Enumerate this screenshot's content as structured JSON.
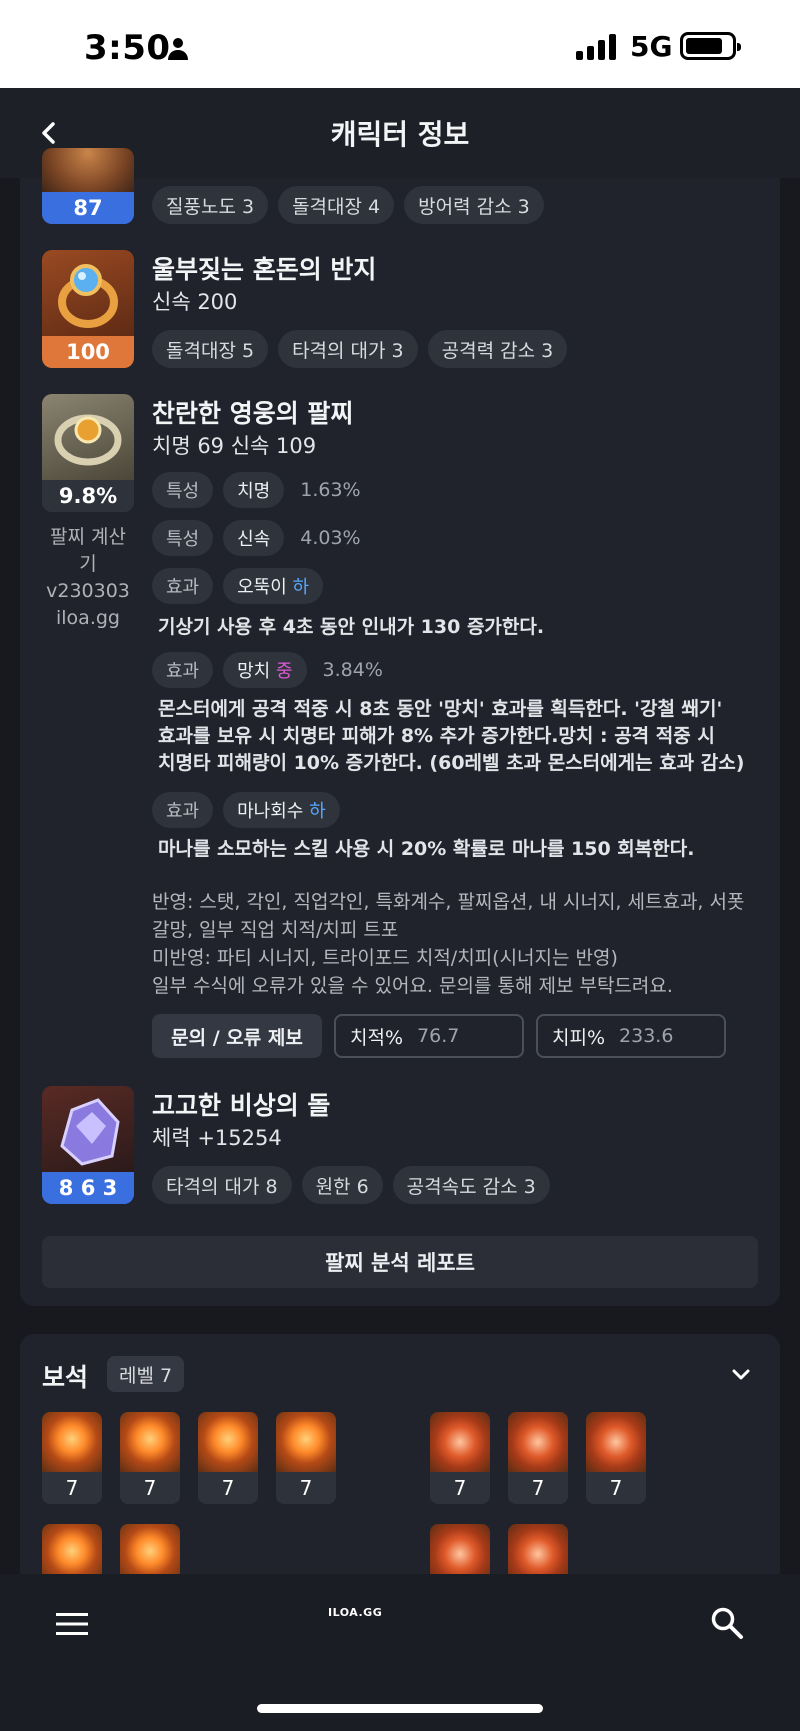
{
  "status_bar": {
    "time": "3:50",
    "network": "5G"
  },
  "header": {
    "title": "캐릭터 정보"
  },
  "items": [
    {
      "level": "87",
      "chips": [
        "질풍노도 3",
        "돌격대장 4",
        "방어력 감소 3"
      ]
    },
    {
      "name": "울부짖는 혼돈의 반지",
      "stat": "신속 200",
      "level": "100",
      "chips": [
        "돌격대장 5",
        "타격의 대가 3",
        "공격력 감소 3"
      ]
    }
  ],
  "bracelet": {
    "name": "찬란한 영웅의 팔찌",
    "stat": "치명 69  신속 109",
    "percent": "9.8%",
    "calc_label": [
      "팔찌 계산기",
      "v230303",
      "iloa.gg"
    ],
    "rows": [
      {
        "type": "특성",
        "name": "치명",
        "value": "1.63%"
      },
      {
        "type": "특성",
        "name": "신속",
        "value": "4.03%"
      },
      {
        "type": "효과",
        "name": "오뚝이",
        "grade": "하",
        "value": ""
      },
      {
        "type": "효과",
        "name": "망치",
        "grade": "중",
        "value": "3.84%"
      },
      {
        "type": "효과",
        "name": "마나회수",
        "grade": "하",
        "value": ""
      }
    ],
    "desc_ottugi": "기상기 사용 후 4초 동안 인내가 130 증가한다.",
    "desc_hammer": [
      "몬스터에게 공격 적중 시 8초 동안 '망치' 효과를 획득한다. '강철 쐐기'",
      "효과를 보유 시 치명타 피해가 8% 추가 증가한다.망치 : 공격 적중 시",
      "치명타 피해량이 10% 증가한다. (60레벨 초과 몬스터에게는 효과 감소)"
    ],
    "desc_mana": "마나를 소모하는 스킬 사용 시 20% 확률로 마나를 150 회복한다.",
    "notes": [
      "반영: 스탯, 각인, 직업각인, 특화계수, 팔찌옵션, 내 시너지, 세트효과, 서폿",
      "갈망, 일부 직업 치적/치피 트포",
      "미반영: 파티 시너지, 트라이포드 치적/치피(시너지는 반영)",
      "일부 수식에 오류가 있을 수 있어요. 문의를 통해 제보 부탁드려요."
    ],
    "report_button": "문의 / 오류 제보",
    "crit_rate_label": "치적%",
    "crit_rate_value": "76.7",
    "crit_dmg_label": "치피%",
    "crit_dmg_value": "233.6"
  },
  "stone": {
    "name": "고고한 비상의 돌",
    "stat": "체력 +15254",
    "level": "8 6 3",
    "chips": [
      "타격의 대가 8",
      "원한 6",
      "공격속도 감소 3"
    ]
  },
  "analysis_button": "팔찌 분석 레포트",
  "gems": {
    "title": "보석",
    "badge": "레벨 7",
    "row1": [
      "7",
      "7",
      "7",
      "7",
      "7",
      "7",
      "7"
    ]
  },
  "bottom_bar": {
    "logo": "ILOA.GG"
  },
  "colors": {
    "accent_blue": "#3a6fe0",
    "accent_orange": "#e0773a",
    "grade_low": "#57a7ff",
    "grade_mid": "#e05ad8"
  }
}
